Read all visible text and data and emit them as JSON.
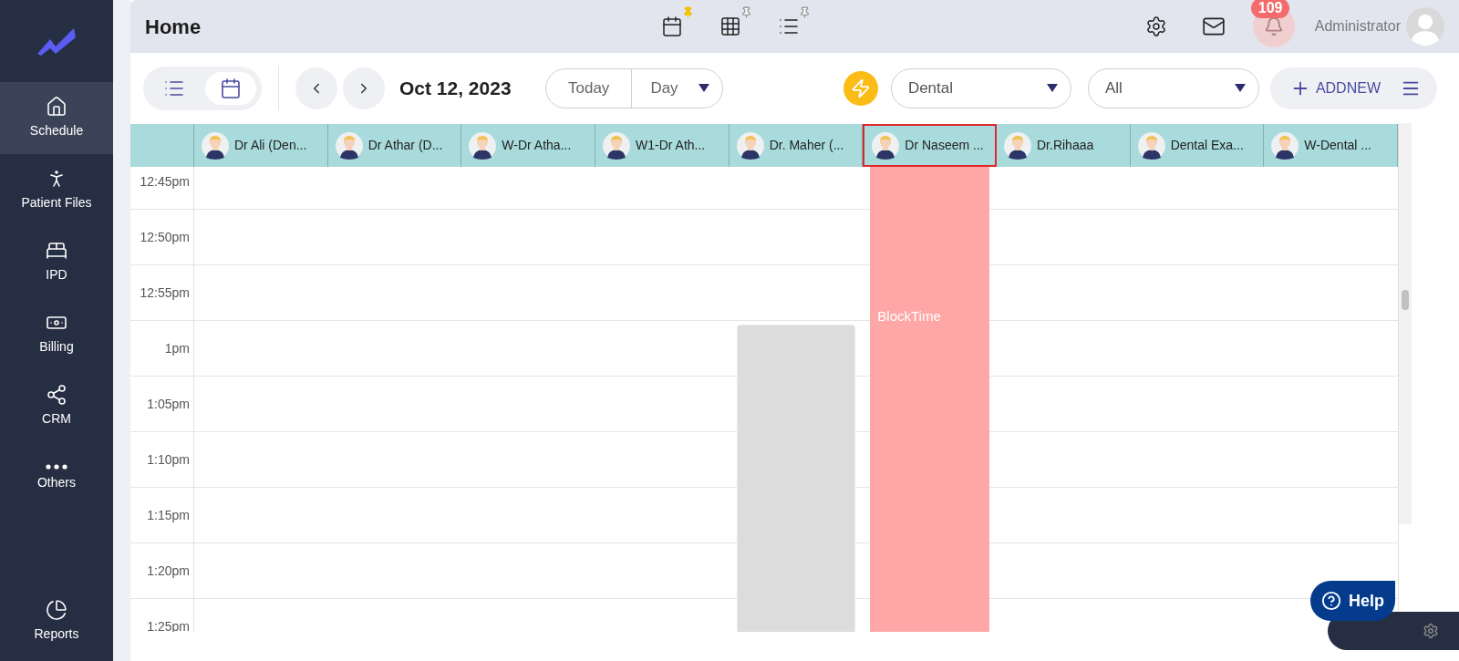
{
  "sidebar": {
    "items": [
      {
        "label": "Schedule",
        "selected": true
      },
      {
        "label": "Patient Files",
        "selected": false
      },
      {
        "label": "IPD",
        "selected": false
      },
      {
        "label": "Billing",
        "selected": false
      },
      {
        "label": "CRM",
        "selected": false
      },
      {
        "label": "Others",
        "selected": false
      }
    ],
    "bottom_item": {
      "label": "Reports",
      "selected": false
    }
  },
  "header": {
    "title": "Home",
    "shortcuts": [
      {
        "pinned": true
      },
      {
        "pinned": false
      },
      {
        "pinned": false
      }
    ],
    "notification_count": "109",
    "user": "Administrator"
  },
  "toolbar": {
    "views": [
      {
        "selected": false
      },
      {
        "selected": true
      }
    ],
    "date": "Oct 12, 2023",
    "today": "Today",
    "range": "Day",
    "department": "Dental",
    "filter": "All",
    "add": "ADDNEW"
  },
  "doctors": [
    {
      "name": "Dr Ali (Den...",
      "selected": false
    },
    {
      "name": "Dr Athar (D...",
      "selected": false
    },
    {
      "name": "W-Dr Atha...",
      "selected": false
    },
    {
      "name": "W1-Dr Ath...",
      "selected": false
    },
    {
      "name": "Dr. Maher (...",
      "selected": false,
      "bookings": [
        {
          "kind": "busy"
        }
      ]
    },
    {
      "name": "Dr Naseem ...",
      "selected": true,
      "bookings": [
        {
          "kind": "block",
          "label": "BlockTime"
        }
      ]
    },
    {
      "name": "Dr.Rihaaa",
      "selected": false
    },
    {
      "name": "Dental Exa...",
      "selected": false
    },
    {
      "name": "W-Dental ...",
      "selected": false
    }
  ],
  "time_slots": [
    "12:45pm",
    "12:50pm",
    "12:55pm",
    "1pm",
    "1:05pm",
    "1:10pm",
    "1:15pm",
    "1:20pm",
    "1:25pm"
  ],
  "help": {
    "label": "Help"
  }
}
